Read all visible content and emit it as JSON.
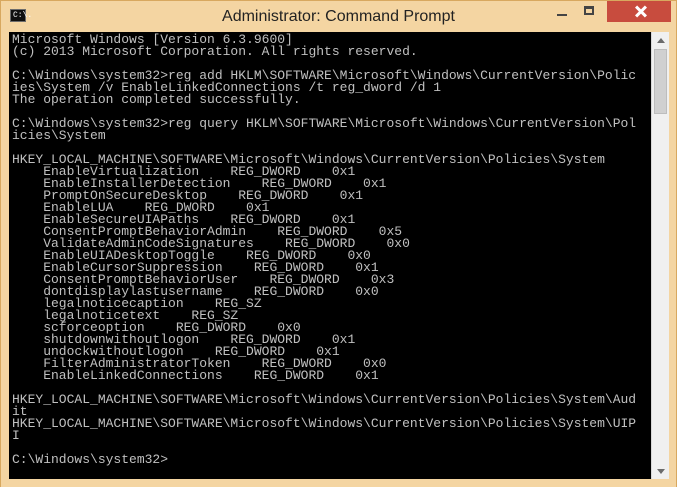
{
  "window": {
    "title": "Administrator: Command Prompt",
    "icon": "command-prompt-icon",
    "icon_text": "C:\\."
  },
  "colors": {
    "frame": "#f4d5a2",
    "close_button": "#c84c3e",
    "console_background": "#000000",
    "console_text": "#c0c0c0"
  },
  "console": {
    "lines": [
      "Microsoft Windows [Version 6.3.9600]",
      "(c) 2013 Microsoft Corporation. All rights reserved.",
      "",
      "C:\\Windows\\system32>reg add HKLM\\SOFTWARE\\Microsoft\\Windows\\CurrentVersion\\Polic",
      "ies\\System /v EnableLinkedConnections /t reg_dword /d 1",
      "The operation completed successfully.",
      "",
      "C:\\Windows\\system32>reg query HKLM\\SOFTWARE\\Microsoft\\Windows\\CurrentVersion\\Pol",
      "icies\\System",
      "",
      "HKEY_LOCAL_MACHINE\\SOFTWARE\\Microsoft\\Windows\\CurrentVersion\\Policies\\System",
      "    EnableVirtualization    REG_DWORD    0x1",
      "    EnableInstallerDetection    REG_DWORD    0x1",
      "    PromptOnSecureDesktop    REG_DWORD    0x1",
      "    EnableLUA    REG_DWORD    0x1",
      "    EnableSecureUIAPaths    REG_DWORD    0x1",
      "    ConsentPromptBehaviorAdmin    REG_DWORD    0x5",
      "    ValidateAdminCodeSignatures    REG_DWORD    0x0",
      "    EnableUIADesktopToggle    REG_DWORD    0x0",
      "    EnableCursorSuppression    REG_DWORD    0x1",
      "    ConsentPromptBehaviorUser    REG_DWORD    0x3",
      "    dontdisplaylastusername    REG_DWORD    0x0",
      "    legalnoticecaption    REG_SZ",
      "    legalnoticetext    REG_SZ",
      "    scforceoption    REG_DWORD    0x0",
      "    shutdownwithoutlogon    REG_DWORD    0x1",
      "    undockwithoutlogon    REG_DWORD    0x1",
      "    FilterAdministratorToken    REG_DWORD    0x0",
      "    EnableLinkedConnections    REG_DWORD    0x1",
      "",
      "HKEY_LOCAL_MACHINE\\SOFTWARE\\Microsoft\\Windows\\CurrentVersion\\Policies\\System\\Aud",
      "it",
      "HKEY_LOCAL_MACHINE\\SOFTWARE\\Microsoft\\Windows\\CurrentVersion\\Policies\\System\\UIP",
      "I",
      "",
      "C:\\Windows\\system32>"
    ]
  }
}
